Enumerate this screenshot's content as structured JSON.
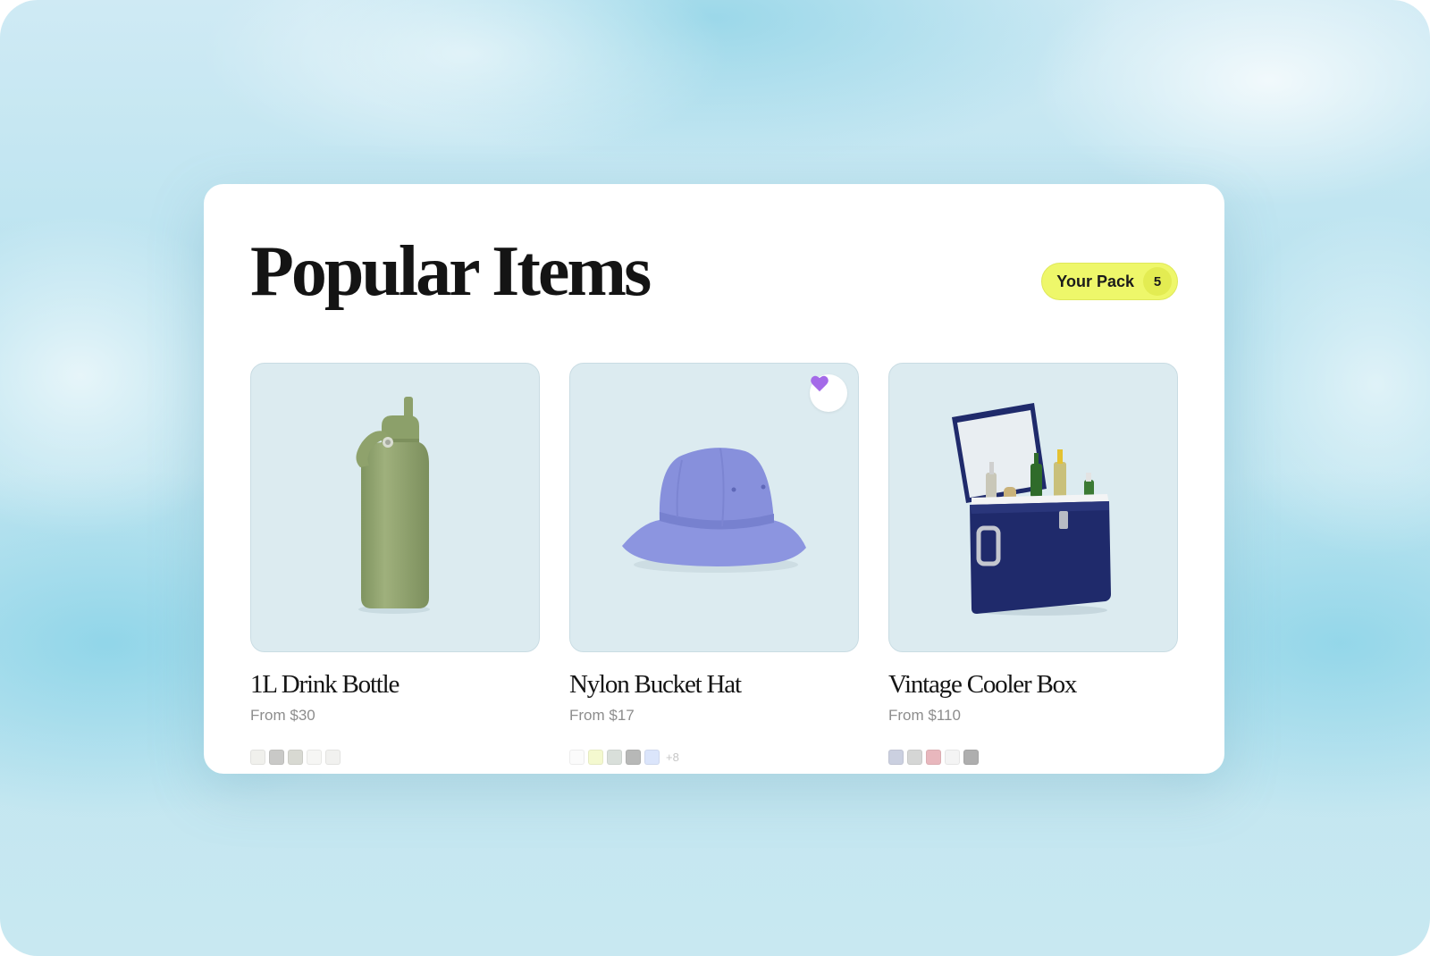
{
  "page": {
    "title": "Popular Items"
  },
  "pack": {
    "label": "Your Pack",
    "count": "5"
  },
  "products": [
    {
      "name": "1L Drink Bottle",
      "price": "From $30",
      "image_icon": "drink-bottle",
      "favorited": false,
      "swatches": [
        "#f0f0ec",
        "#c9c9c7",
        "#d8d9d2",
        "#f6f6f4",
        "#f1f1ef"
      ],
      "more_colors": ""
    },
    {
      "name": "Nylon Bucket Hat",
      "price": "From $17",
      "image_icon": "bucket-hat",
      "favorited": true,
      "swatches": [
        "#fbfbfb",
        "#f4f9cf",
        "#d9dfda",
        "#b7b8b7",
        "#dbe5fb"
      ],
      "more_colors": "+8"
    },
    {
      "name": "Vintage Cooler Box",
      "price": "From $110",
      "image_icon": "cooler-box",
      "favorited": false,
      "swatches": [
        "#cbd0e0",
        "#d5d6d5",
        "#e8b7bd",
        "#f4f4f4",
        "#aeaeae"
      ],
      "more_colors": ""
    }
  ],
  "colors": {
    "pack_accent": "#eef76a",
    "heart": "#a46ae8",
    "image_bg": "#dcebf0"
  }
}
